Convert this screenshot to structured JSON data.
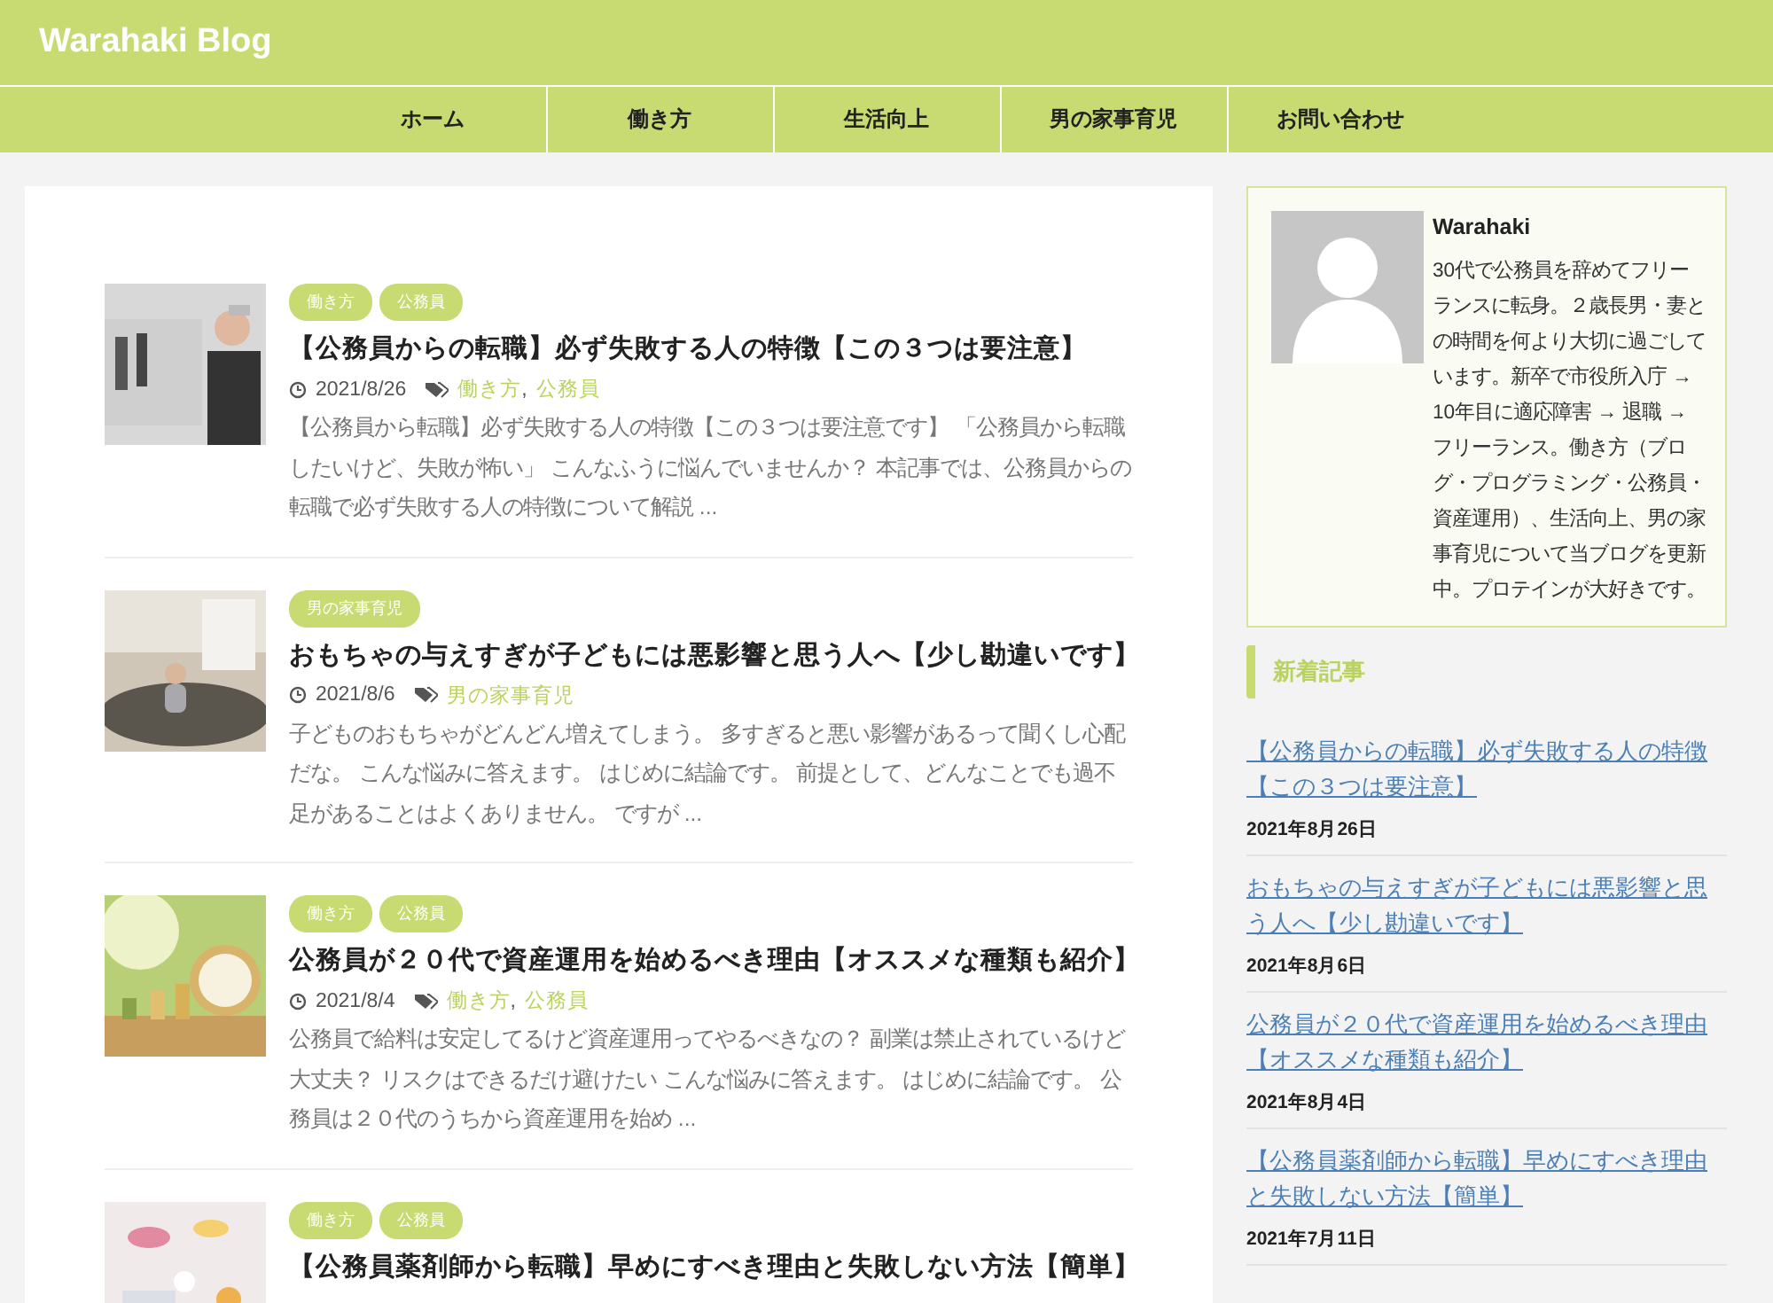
{
  "site_title": "Warahaki Blog",
  "nav": [
    {
      "label": "ホーム"
    },
    {
      "label": "働き方"
    },
    {
      "label": "生活向上"
    },
    {
      "label": "男の家事育児"
    },
    {
      "label": "お問い合わせ"
    }
  ],
  "posts": [
    {
      "badges": [
        "働き方",
        "公務員"
      ],
      "title": "【公務員からの転職】必ず失敗する人の特徴【この３つは要注意】",
      "date": "2021/8/26",
      "categories": [
        "働き方",
        "公務員"
      ],
      "separator": ",",
      "excerpt": "【公務員から転職】必ず失敗する人の特徴【この３つは要注意です】 「公務員から転職したいけど、失敗が怖い」 こんなふうに悩んでいませんか？ 本記事では、公務員からの転職で必ず失敗する人の特徴について解説 ..."
    },
    {
      "badges": [
        "男の家事育児"
      ],
      "title": "おもちゃの与えすぎが子どもには悪影響と思う人へ【少し勘違いです】",
      "date": "2021/8/6",
      "categories": [
        "男の家事育児"
      ],
      "excerpt": "子どものおもちゃがどんどん増えてしまう。 多すぎると悪い影響があるって聞くし心配だな。 こんな悩みに答えます。 はじめに結論です。 前提として、どんなことでも過不足があることはよくありません。 ですが ..."
    },
    {
      "badges": [
        "働き方",
        "公務員"
      ],
      "title": "公務員が２０代で資産運用を始めるべき理由【オススメな種類も紹介】",
      "date": "2021/8/4",
      "categories": [
        "働き方",
        "公務員"
      ],
      "separator": ",",
      "excerpt": "公務員で給料は安定してるけど資産運用ってやるべきなの？ 副業は禁止されているけど大丈夫？ リスクはできるだけ避けたい こんな悩みに答えます。 はじめに結論です。 公務員は２０代のうちから資産運用を始め ..."
    },
    {
      "badges": [
        "働き方",
        "公務員"
      ],
      "title": "【公務員薬剤師から転職】早めにすべき理由と失敗しない方法【簡単】"
    }
  ],
  "profile": {
    "name": "Warahaki",
    "bio": "30代で公務員を辞めてフリーランスに転身。２歳長男・妻との時間を何より大切に過ごしています。新卒で市役所入庁 → 10年目に適応障害 → 退職 → フリーランス。働き方（ブログ・プログラミング・公務員・資産運用）、生活向上、男の家事育児について当ブログを更新中。プロテインが大好きです。"
  },
  "recent": {
    "heading": "新着記事",
    "items": [
      {
        "title": "【公務員からの転職】必ず失敗する人の特徴【この３つは要注意】",
        "date": "2021年8月26日"
      },
      {
        "title": "おもちゃの与えすぎが子どもには悪影響と思う人へ【少し勘違いです】",
        "date": "2021年8月6日"
      },
      {
        "title": "公務員が２０代で資産運用を始めるべき理由【オススメな種類も紹介】",
        "date": "2021年8月4日"
      },
      {
        "title": "【公務員薬剤師から転職】早めにすべき理由と失敗しない方法【簡単】",
        "date": "2021年7月11日"
      }
    ]
  }
}
